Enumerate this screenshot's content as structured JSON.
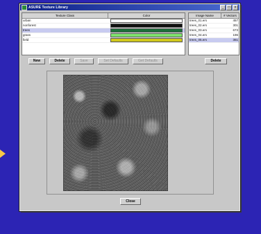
{
  "window": {
    "title": "ASURE Texture Library"
  },
  "texture_table": {
    "headers": [
      "Texture Class",
      "Color"
    ],
    "rows": [
      {
        "name": "urban",
        "color": "#ffffff"
      },
      {
        "name": "nonforest",
        "color": "#111111"
      },
      {
        "name": "trees",
        "color": "#1d6f3b"
      },
      {
        "name": "grass",
        "color": "#7fe36d"
      },
      {
        "name": "field",
        "color": "#d2c91c"
      }
    ],
    "selected_index": 2
  },
  "image_table": {
    "headers": [
      "Image Name",
      "# Vectors"
    ],
    "rows": [
      {
        "name": "trees_01.ers",
        "vectors": "457"
      },
      {
        "name": "trees_02.ers",
        "vectors": "301"
      },
      {
        "name": "trees_03.ers",
        "vectors": "673"
      },
      {
        "name": "trees_04.ers",
        "vectors": "196"
      },
      {
        "name": "trees_05.ers",
        "vectors": "361"
      }
    ],
    "selected_index": 4
  },
  "buttons": {
    "new": "New",
    "delete": "Delete",
    "save": "Save",
    "set_defaults": "Set Defaults",
    "get_defaults": "Get Defaults",
    "delete_image": "Delete",
    "close": "Close"
  },
  "title_buttons": {
    "minimize": "_",
    "maximize": "□",
    "close": "×"
  },
  "colors": {
    "desktop": "#2c24b4",
    "titlebar": "#0d1f86",
    "selection": "#c8cbf0"
  }
}
